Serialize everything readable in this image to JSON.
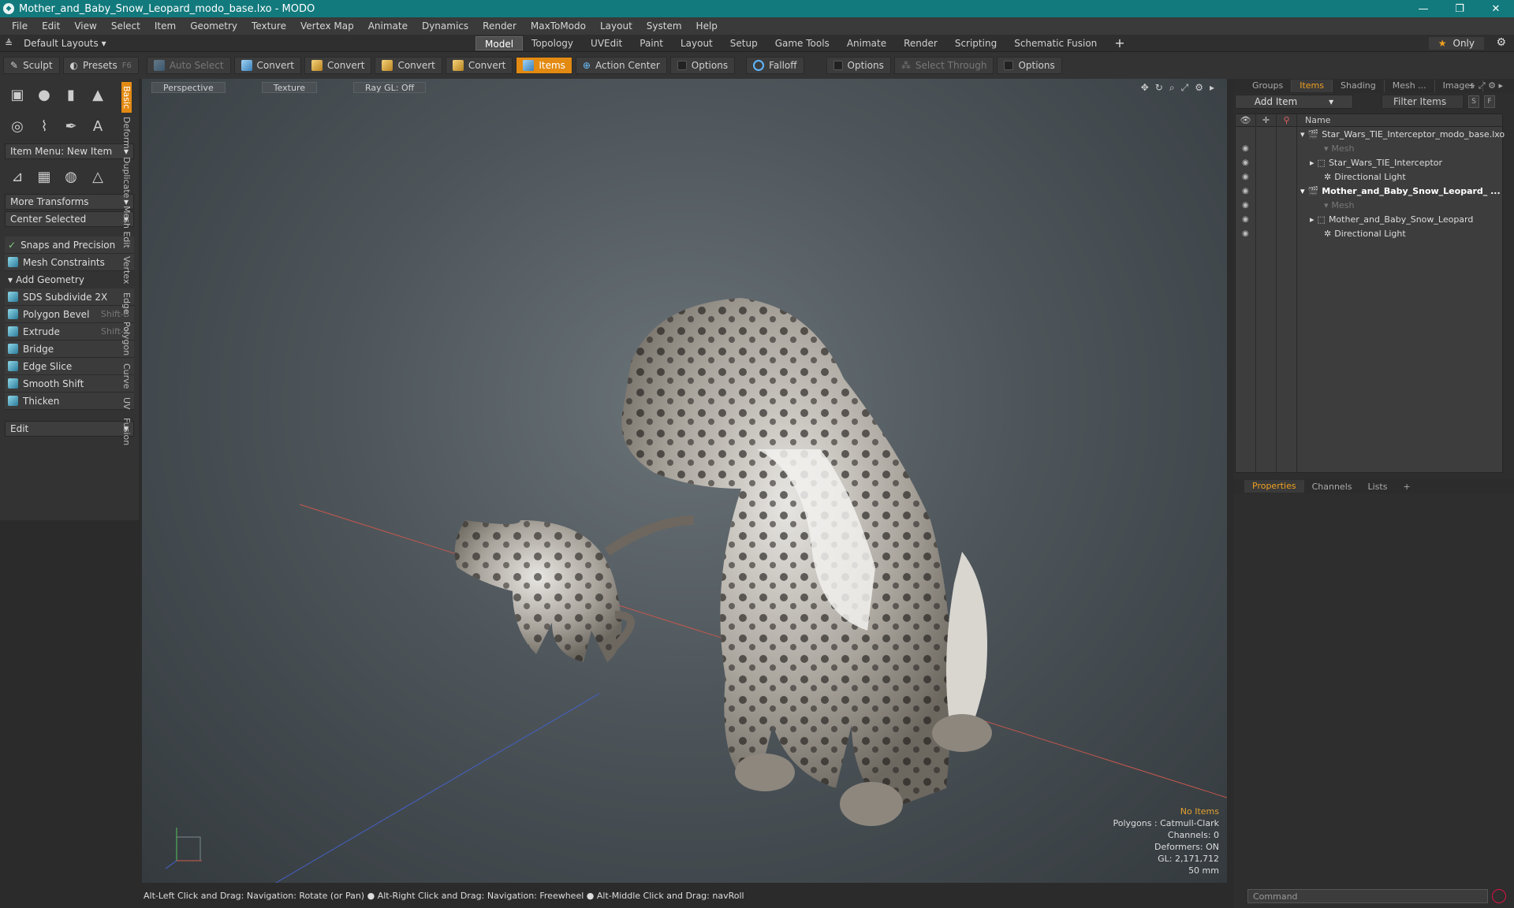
{
  "window": {
    "title": "Mother_and_Baby_Snow_Leopard_modo_base.lxo - MODO",
    "min": "—",
    "max": "❐",
    "close": "✕"
  },
  "menu": [
    "File",
    "Edit",
    "View",
    "Select",
    "Item",
    "Geometry",
    "Texture",
    "Vertex Map",
    "Animate",
    "Dynamics",
    "Render",
    "MaxToModo",
    "Layout",
    "System",
    "Help"
  ],
  "layoutbar": {
    "layouts_label": "Default Layouts ▾",
    "tabs": [
      "Model",
      "Topology",
      "UVEdit",
      "Paint",
      "Layout",
      "Setup",
      "Game Tools",
      "Animate",
      "Render",
      "Scripting",
      "Schematic Fusion"
    ],
    "active_tab": "Model",
    "plus": "+",
    "only_label": "Only"
  },
  "toolbar": {
    "sculpt": "Sculpt",
    "presets": "Presets",
    "presets_key": "F6",
    "auto_select": "Auto Select",
    "convert1": "Convert",
    "convert2": "Convert",
    "convert3": "Convert",
    "convert4": "Convert",
    "items": "Items",
    "action_center": "Action Center",
    "options1": "Options",
    "falloff": "Falloff",
    "options2": "Options",
    "select_through": "Select Through",
    "options3": "Options"
  },
  "leftpanel": {
    "item_menu": "Item Menu: New Item",
    "more_transforms": "More Transforms",
    "center_selected": "Center Selected",
    "snaps": "Snaps and Precision",
    "mesh_constraints": "Mesh Constraints",
    "add_geometry": "Add Geometry",
    "tools": [
      {
        "label": "SDS Subdivide 2X",
        "shortcut": ""
      },
      {
        "label": "Polygon Bevel",
        "shortcut": "Shift-B"
      },
      {
        "label": "Extrude",
        "shortcut": "Shift-X"
      },
      {
        "label": "Bridge",
        "shortcut": ""
      },
      {
        "label": "Edge Slice",
        "shortcut": ""
      },
      {
        "label": "Smooth Shift",
        "shortcut": ""
      },
      {
        "label": "Thicken",
        "shortcut": ""
      }
    ],
    "edit": "Edit",
    "vtabs": [
      "Basic",
      "Deform",
      "Duplicate",
      "Mesh Edit",
      "Vertex",
      "Edge",
      "Polygon",
      "Curve",
      "UV",
      "Fusion"
    ]
  },
  "viewport": {
    "view": "Perspective",
    "shading": "Texture",
    "raygl": "Ray GL: Off",
    "info": {
      "selection": "No Items",
      "polygons": "Polygons : Catmull-Clark",
      "channels": "Channels: 0",
      "deformers": "Deformers: ON",
      "gl": "GL: 2,171,712",
      "lens": "50 mm"
    }
  },
  "statusbar": "Alt-Left Click and Drag: Navigation: Rotate (or Pan) ● Alt-Right Click and Drag: Navigation: Freewheel ● Alt-Middle Click and Drag: navRoll",
  "rightpanel": {
    "tabs": [
      "Groups",
      "Items",
      "Shading",
      "Mesh ...",
      "Images"
    ],
    "active_tab": "Items",
    "add_item": "Add Item",
    "filter": "Filter Items",
    "s": "S",
    "f": "F",
    "name_col": "Name",
    "tree": [
      {
        "label": "Star_Wars_TIE_Interceptor_modo_base.lxo",
        "style": "normal"
      },
      {
        "label": "Mesh",
        "style": "dim"
      },
      {
        "label": "Star_Wars_TIE_Interceptor",
        "style": "normal"
      },
      {
        "label": "Directional Light",
        "style": "normal"
      },
      {
        "label": "Mother_and_Baby_Snow_Leopard_ ...",
        "style": "bold"
      },
      {
        "label": "Mesh",
        "style": "dim"
      },
      {
        "label": "Mother_and_Baby_Snow_Leopard",
        "style": "normal"
      },
      {
        "label": "Directional Light",
        "style": "normal"
      }
    ],
    "props_tabs": [
      "Properties",
      "Channels",
      "Lists"
    ],
    "props_active": "Properties",
    "command_placeholder": "Command"
  }
}
